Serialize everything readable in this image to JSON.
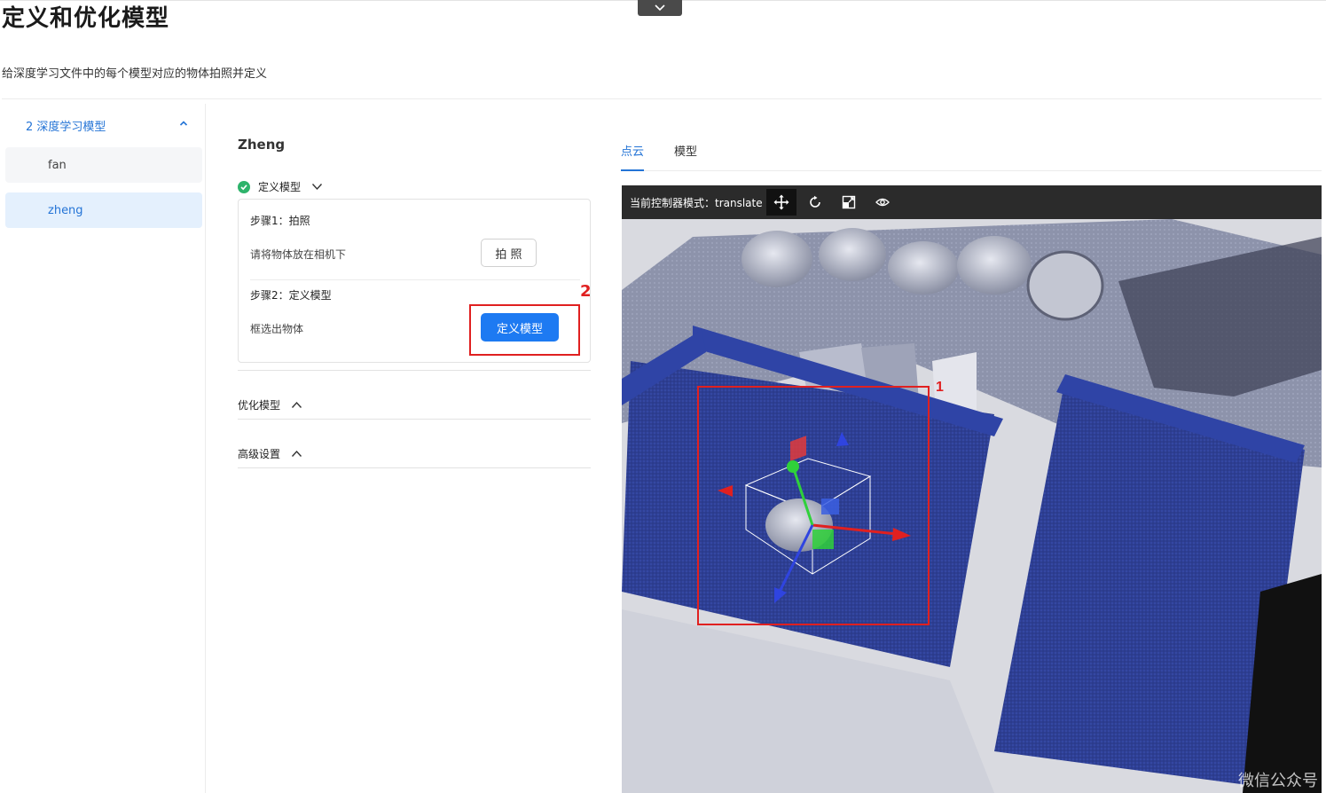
{
  "page": {
    "title": "定义和优化模型",
    "description": "给深度学习文件中的每个模型对应的物体拍照并定义"
  },
  "sidebar": {
    "group_label": "2 深度学习模型",
    "items": [
      {
        "label": "fan",
        "active": false
      },
      {
        "label": "zheng",
        "active": true
      }
    ]
  },
  "model": {
    "name": "Zheng",
    "define_section": {
      "title": "定义模型",
      "step1": {
        "title": "步骤1：拍照",
        "text": "请将物体放在相机下",
        "button": "拍 照"
      },
      "step2": {
        "title": "步骤2：定义模型",
        "text": "框选出物体",
        "button": "定义模型"
      }
    },
    "optimize_section": {
      "title": "优化模型"
    },
    "advanced_section": {
      "title": "高级设置"
    }
  },
  "annotations": {
    "marker_1": "1",
    "marker_2": "2"
  },
  "viewer": {
    "tabs": [
      {
        "label": "点云",
        "active": true
      },
      {
        "label": "模型",
        "active": false
      }
    ],
    "toolbar_label": "当前控制器模式：translate",
    "toolbar_icons": [
      "move-icon",
      "rotate-icon",
      "scale-icon",
      "eye-icon"
    ],
    "watermark": "微信公众号"
  },
  "colors": {
    "accent": "#1d7af2",
    "success": "#2eb36b",
    "annotation": "#e02020",
    "toolbar_bg": "#2b2b2b"
  }
}
